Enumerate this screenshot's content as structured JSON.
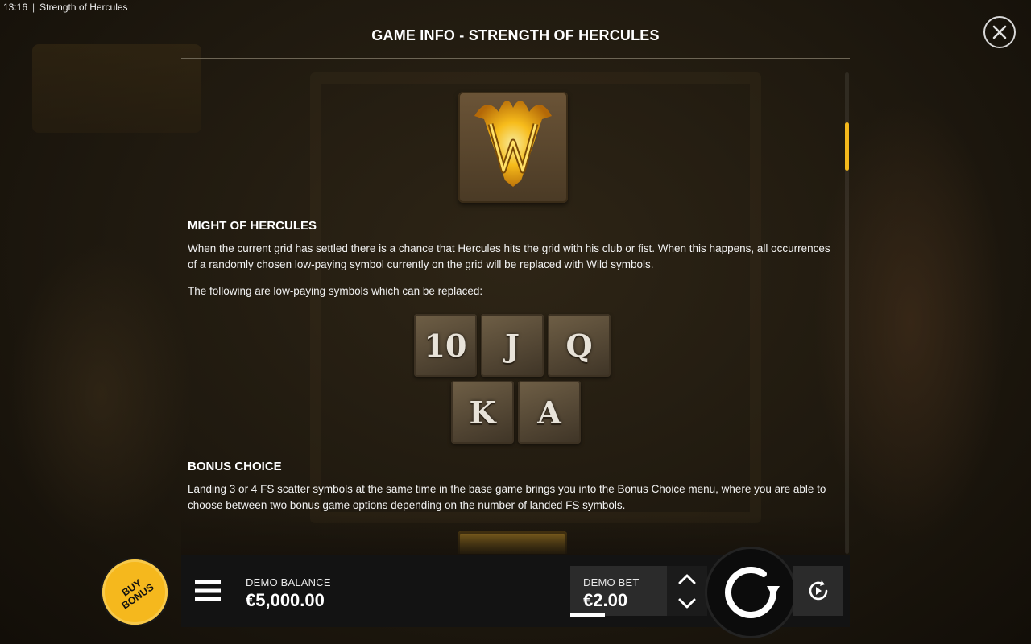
{
  "status_bar": {
    "time": "13:16",
    "separator": "|",
    "title": "Strength of Hercules"
  },
  "header": {
    "title": "GAME INFO - STRENGTH OF HERCULES"
  },
  "icons": {
    "close": "close-icon",
    "wild": "wild-symbol-icon",
    "menu": "hamburger-menu-icon",
    "bet_up": "chevron-up-icon",
    "bet_down": "chevron-down-icon",
    "spin": "spin-icon",
    "autoplay": "autoplay-icon"
  },
  "sections": {
    "might": {
      "title": "MIGHT OF HERCULES",
      "text": "When the current grid has settled there is a chance that Hercules hits the grid with his club or fist. When this happens, all occurrences of a randomly chosen low-paying symbol currently on the grid will be replaced with Wild symbols.",
      "list_intro": "The following are low-paying symbols which can be replaced:",
      "symbols": [
        "10",
        "J",
        "Q",
        "K",
        "A"
      ]
    },
    "bonus_choice": {
      "title": "BONUS CHOICE",
      "text": "Landing 3 or 4 FS scatter symbols at the same time in the base game brings you into the Bonus Choice menu, where you are able to choose between two bonus game options depending on the number of landed FS symbols."
    }
  },
  "footer": {
    "buy_bonus": "BUY\nBONUS",
    "balance_label": "DEMO BALANCE",
    "balance_value": "€5,000.00",
    "bet_label": "DEMO BET",
    "bet_value": "€2.00"
  },
  "colors": {
    "accent": "#f5b81d",
    "bar": "#131313",
    "panel": "#2b2b2b"
  }
}
